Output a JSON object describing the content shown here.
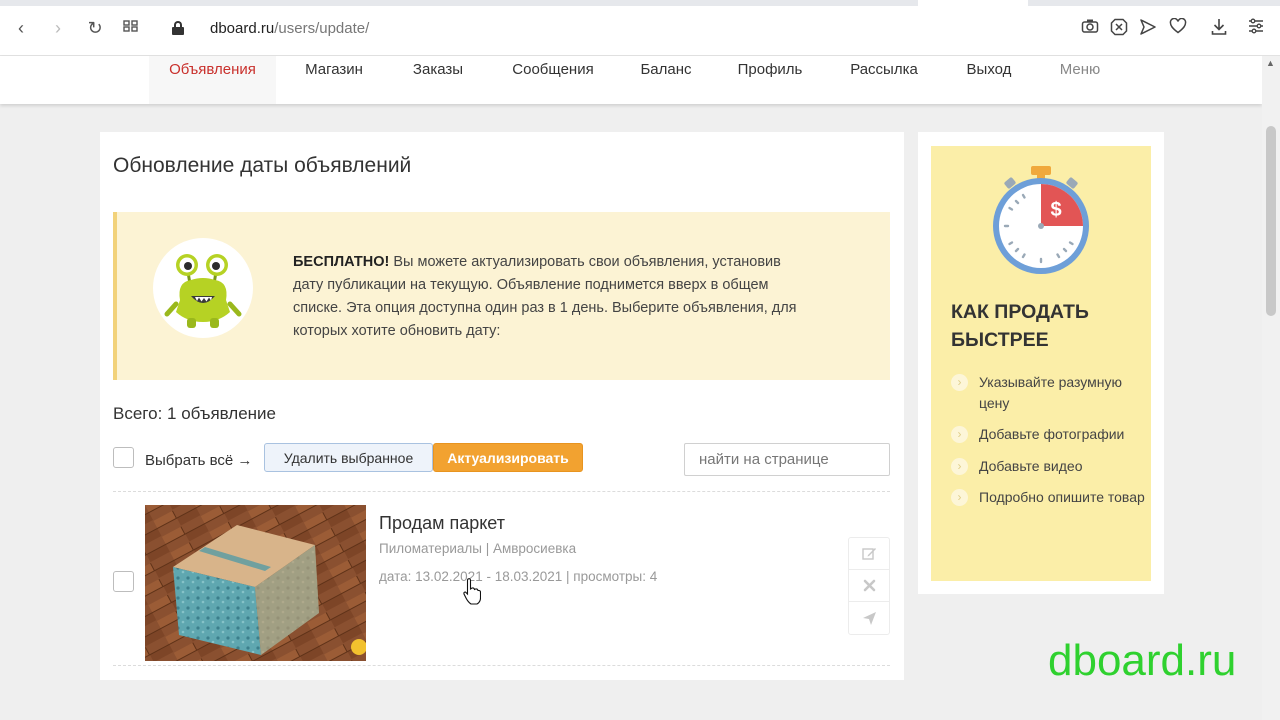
{
  "browser": {
    "url_domain": "dboard.ru",
    "url_path": "/users/update/",
    "back_glyph": "‹",
    "forward_glyph": "›",
    "reload_glyph": "↻",
    "icons": [
      "back-icon",
      "forward-icon",
      "reload-icon",
      "tabs-grid-icon",
      "lock-icon",
      "camera-icon",
      "block-icon",
      "send-icon",
      "heart-icon",
      "download-icon",
      "menu-icon"
    ]
  },
  "nav": {
    "items": [
      {
        "label": "Объявления",
        "active": true
      },
      {
        "label": "Магазин"
      },
      {
        "label": "Заказы"
      },
      {
        "label": "Сообщения"
      },
      {
        "label": "Баланс"
      },
      {
        "label": "Профиль"
      },
      {
        "label": "Рассылка"
      },
      {
        "label": "Выход"
      },
      {
        "label": "Меню",
        "muted": true
      }
    ]
  },
  "main": {
    "title": "Обновление даты объявлений",
    "info": {
      "bold": "БЕСПЛАТНО!",
      "text": " Вы можете актуализировать свои объявления, установив дату публикации на текущую. Объявление поднимется вверх в общем списке. Эта опция доступна один раз в 1 день. Выберите объявления, для которых хотите обновить дату:"
    },
    "total": "Всего: 1 объявление",
    "select_all_label": "Выбрать всё →",
    "delete_button": "Удалить выбранное",
    "update_button": "Актуализировать",
    "search_placeholder": "найти на странице",
    "listing": {
      "title": "Продам паркет",
      "category": "Пиломатериалы | Амвросиевка",
      "meta": "дата: 13.02.2021 - 18.03.2021 | просмотры: 4",
      "actions": [
        "edit-icon",
        "delete-icon",
        "send-icon"
      ]
    }
  },
  "side": {
    "title": "КАК ПРОДАТЬ БЫСТРЕЕ",
    "tips": [
      "Указывайте разумную цену",
      "Добавьте фотографии",
      "Добавьте видео",
      "Подробно опишите товар"
    ],
    "tip_glyph": "›",
    "stopwatch_symbol": "$"
  },
  "watermark": "dboard.ru",
  "colors": {
    "accent_red": "#c9302c",
    "update_button": "#f2a230",
    "info_bg": "#fcf3d4",
    "side_bg": "#fbeea8",
    "watermark": "#2fd12f"
  }
}
